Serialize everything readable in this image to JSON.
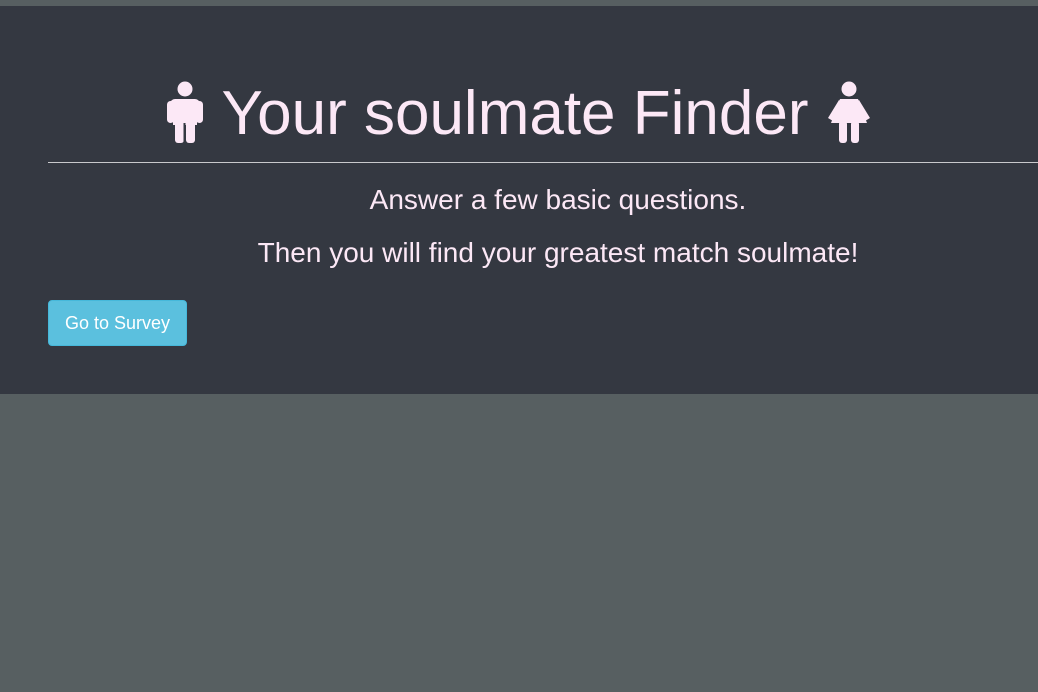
{
  "header": {
    "title": "Your soulmate Finder",
    "left_icon": "male-icon",
    "right_icon": "female-icon",
    "title_color": "#fce8f6"
  },
  "intro": {
    "line1": "Answer a few basic questions.",
    "line2": "Then you will find your greatest match soulmate!"
  },
  "actions": {
    "survey_button_label": "Go to Survey",
    "survey_button_color": "#5bc0de"
  },
  "colors": {
    "page_background": "#575f61",
    "jumbotron_background": "#343841"
  }
}
